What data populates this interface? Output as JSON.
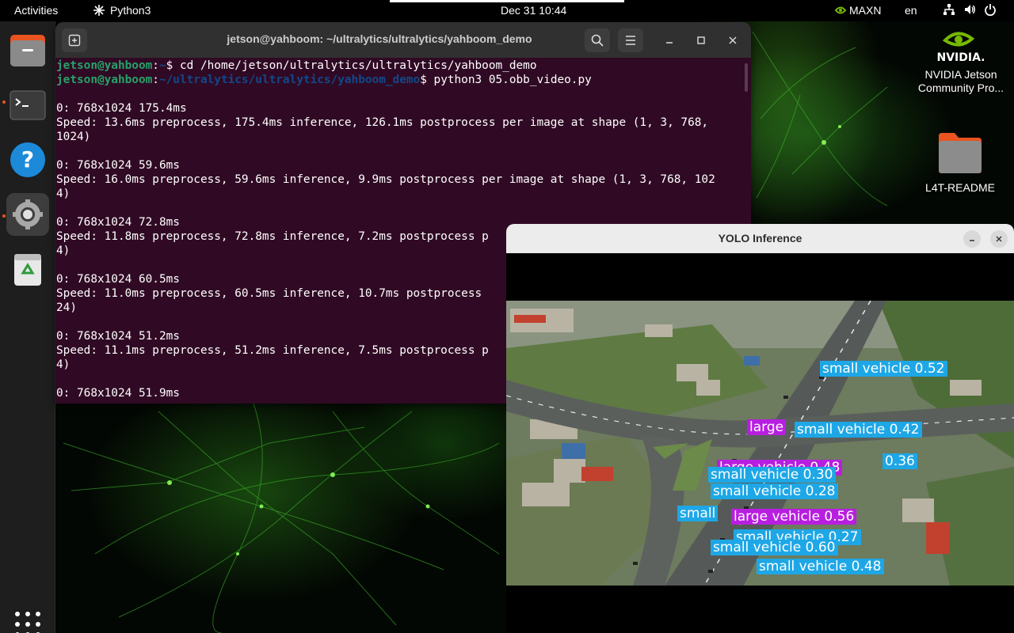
{
  "topbar": {
    "activities": "Activities",
    "app_name": "Python3",
    "clock": "Dec 31  10:44",
    "power_mode": "MAXN",
    "language": "en"
  },
  "dock": {
    "items": [
      "files",
      "terminal",
      "help",
      "settings",
      "trash"
    ],
    "apps_grid": "show-applications"
  },
  "desktop": {
    "nvidia_label": "NVIDIA Jetson Community Pro...",
    "readme_label": "L4T-README"
  },
  "terminal": {
    "title": "jetson@yahboom: ~/ultralytics/ultralytics/yahboom_demo",
    "prompt_user": "jetson@yahboom",
    "lines": [
      {
        "type": "prompt",
        "path": "~",
        "cmd": "$ cd /home/jetson/ultralytics/ultralytics/yahboom_demo"
      },
      {
        "type": "prompt",
        "path": "~/ultralytics/ultralytics/yahboom_demo",
        "cmd": "$ python3 05.obb_video.py"
      },
      {
        "type": "text",
        "text": ""
      },
      {
        "type": "text",
        "text": "0: 768x1024 175.4ms"
      },
      {
        "type": "text",
        "text": "Speed: 13.6ms preprocess, 175.4ms inference, 126.1ms postprocess per image at shape (1, 3, 768,"
      },
      {
        "type": "text",
        "text": "1024)"
      },
      {
        "type": "text",
        "text": ""
      },
      {
        "type": "text",
        "text": "0: 768x1024 59.6ms"
      },
      {
        "type": "text",
        "text": "Speed: 16.0ms preprocess, 59.6ms inference, 9.9ms postprocess per image at shape (1, 3, 768, 102"
      },
      {
        "type": "text",
        "text": "4)"
      },
      {
        "type": "text",
        "text": ""
      },
      {
        "type": "text",
        "text": "0: 768x1024 72.8ms"
      },
      {
        "type": "text",
        "text": "Speed: 11.8ms preprocess, 72.8ms inference, 7.2ms postprocess p"
      },
      {
        "type": "text",
        "text": "4)"
      },
      {
        "type": "text",
        "text": ""
      },
      {
        "type": "text",
        "text": "0: 768x1024 60.5ms"
      },
      {
        "type": "text",
        "text": "Speed: 11.0ms preprocess, 60.5ms inference, 10.7ms postprocess"
      },
      {
        "type": "text",
        "text": "24)"
      },
      {
        "type": "text",
        "text": ""
      },
      {
        "type": "text",
        "text": "0: 768x1024 51.2ms"
      },
      {
        "type": "text",
        "text": "Speed: 11.1ms preprocess, 51.2ms inference, 7.5ms postprocess p"
      },
      {
        "type": "text",
        "text": "4)"
      },
      {
        "type": "text",
        "text": ""
      },
      {
        "type": "text",
        "text": "0: 768x1024 51.9ms"
      }
    ]
  },
  "yolo": {
    "title": "YOLO Inference",
    "detections": [
      {
        "label": "small vehicle 0.52",
        "cls": "small"
      },
      {
        "label": "large",
        "cls": "large"
      },
      {
        "label": "small vehicle 0.42",
        "cls": "small"
      },
      {
        "label": "0.36",
        "cls": "small"
      },
      {
        "label": "large vehicle 0.48",
        "cls": "large"
      },
      {
        "label": "small vehicle 0.30",
        "cls": "small"
      },
      {
        "label": "small vehicle 0.28",
        "cls": "small"
      },
      {
        "label": "small",
        "cls": "small"
      },
      {
        "label": "large vehicle 0.56",
        "cls": "large"
      },
      {
        "label": "small vehicle 0.27",
        "cls": "small"
      },
      {
        "label": "small vehicle 0.60",
        "cls": "small"
      },
      {
        "label": "small vehicle 0.48",
        "cls": "small"
      }
    ]
  },
  "colors": {
    "terminal_bg": "#300a24",
    "prompt_user": "#26a269",
    "prompt_path": "#12488b",
    "small_vehicle": "#1ea7e6",
    "large_vehicle": "#b81ee0",
    "accent": "#e95420"
  }
}
